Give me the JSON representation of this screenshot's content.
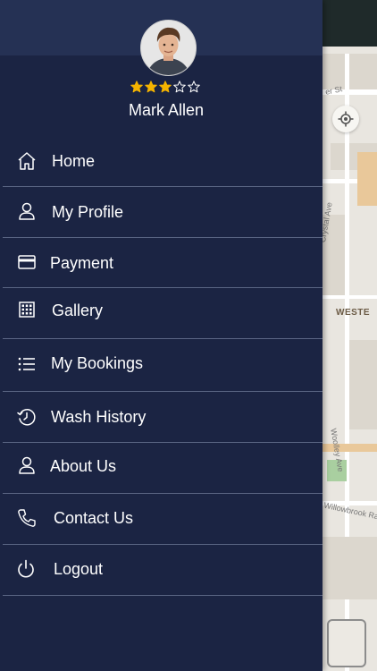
{
  "profile": {
    "name": "Mark Allen",
    "rating": 3,
    "rating_max": 5,
    "star_color": "#f5b400"
  },
  "menu": {
    "items": [
      {
        "label": "Home",
        "icon": "home-icon"
      },
      {
        "label": "My Profile",
        "icon": "user-icon"
      },
      {
        "label": "Payment",
        "icon": "credit-card-icon"
      },
      {
        "label": "Gallery",
        "icon": "grid-icon"
      },
      {
        "label": "My Bookings",
        "icon": "list-icon"
      },
      {
        "label": "Wash History",
        "icon": "history-icon"
      },
      {
        "label": "About Us",
        "icon": "user-icon"
      },
      {
        "label": "Contact Us",
        "icon": "phone-icon"
      },
      {
        "label": "Logout",
        "icon": "power-icon"
      }
    ]
  },
  "map": {
    "labels": [
      "er St",
      "Crystal Ave",
      "WESTE",
      "Woolley Ave",
      "Willowbrook Ra"
    ]
  },
  "colors": {
    "drawer_bg": "#1b2443",
    "header_bg": "#253154",
    "divider": "#5a6583",
    "text": "#ffffff"
  }
}
